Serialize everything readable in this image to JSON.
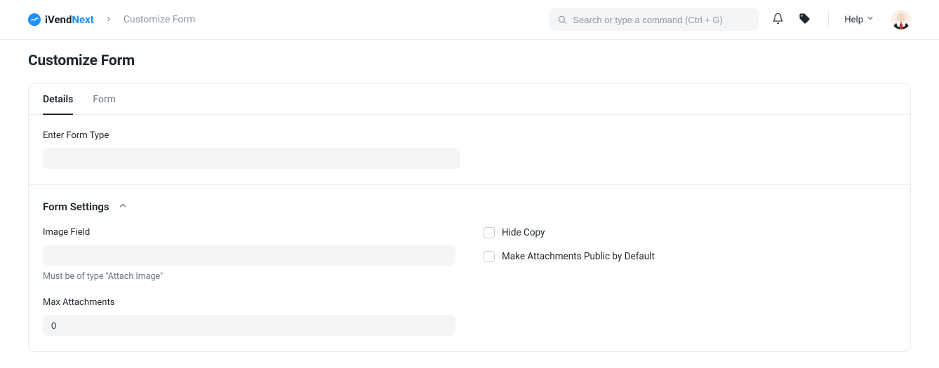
{
  "brand": {
    "part1": "iVend",
    "part2": "Next"
  },
  "breadcrumbs": {
    "current": "Customize Form"
  },
  "search": {
    "placeholder": "Search or type a command (Ctrl + G)"
  },
  "nav": {
    "help_label": "Help"
  },
  "page": {
    "title": "Customize Form"
  },
  "tabs": {
    "details": "Details",
    "form": "Form"
  },
  "section_details": {
    "form_type_label": "Enter Form Type",
    "form_type_value": ""
  },
  "section_form_settings": {
    "heading": "Form Settings",
    "image_field_label": "Image Field",
    "image_field_value": "",
    "image_field_help": "Must be of type \"Attach Image\"",
    "max_attachments_label": "Max Attachments",
    "max_attachments_value": "0",
    "hide_copy_label": "Hide Copy",
    "make_attachments_public_label": "Make Attachments Public by Default"
  }
}
